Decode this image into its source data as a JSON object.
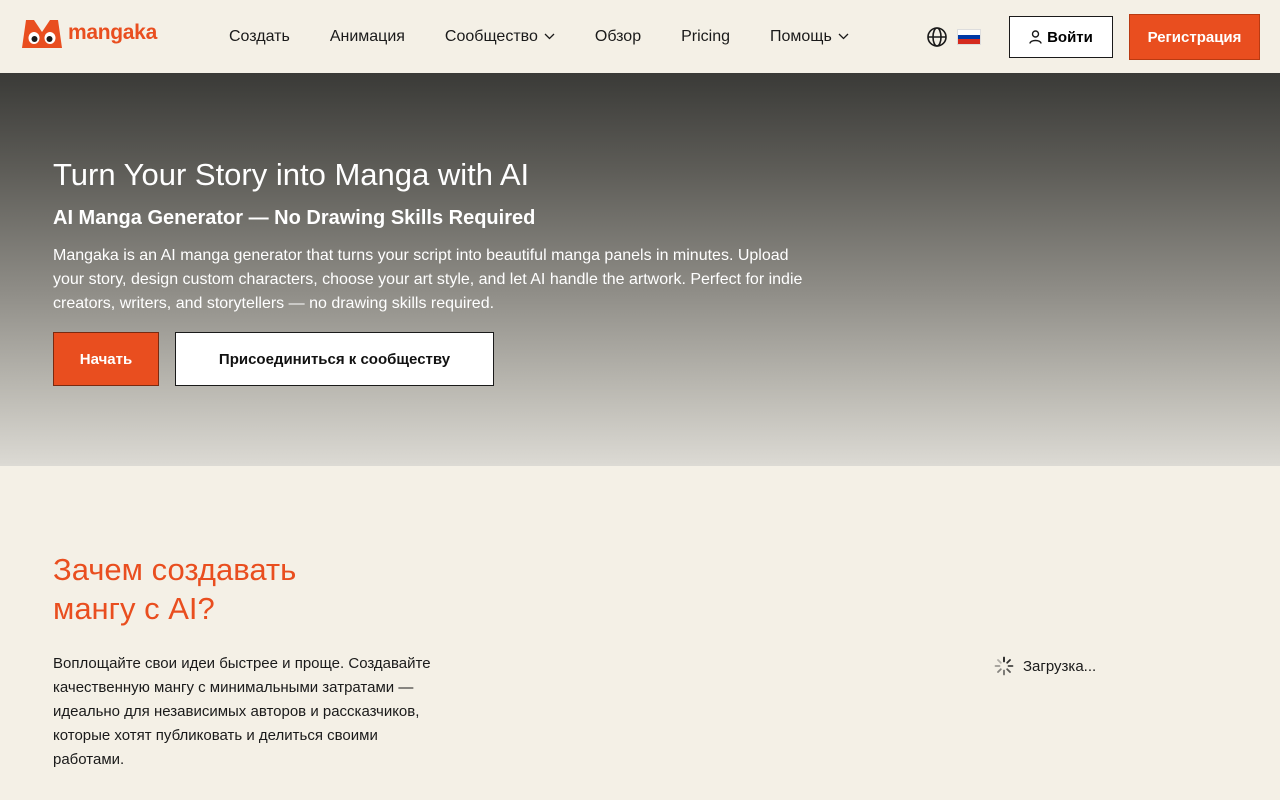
{
  "header": {
    "logo_text": "mangaka",
    "nav": [
      {
        "label": "Создать",
        "has_dropdown": false
      },
      {
        "label": "Анимация",
        "has_dropdown": false
      },
      {
        "label": "Сообщество",
        "has_dropdown": true
      },
      {
        "label": "Обзор",
        "has_dropdown": false
      },
      {
        "label": "Pricing",
        "has_dropdown": false
      },
      {
        "label": "Помощь",
        "has_dropdown": true
      }
    ],
    "login_label": "Войти",
    "register_label": "Регистрация"
  },
  "hero": {
    "title": "Turn Your Story into Manga with AI",
    "subtitle": "AI Manga Generator — No Drawing Skills Required",
    "description": "Mangaka is an AI manga generator that turns your script into beautiful manga panels in minutes. Upload your story, design custom characters, choose your art style, and let AI handle the artwork. Perfect for indie creators, writers, and storytellers — no drawing skills required.",
    "start_label": "Начать",
    "join_label": "Присоединиться к сообществу"
  },
  "why": {
    "title": "Зачем создавать мангу с AI?",
    "description": "Воплощайте свои идеи быстрее и проще. Создавайте качественную мангу с минимальными затратами — идеально для независимых авторов и рассказчиков, которые хотят публиковать и делиться своими работами.",
    "loading_label": "Загрузка..."
  },
  "colors": {
    "accent": "#e94e1f",
    "background": "#f4f0e6"
  },
  "icons": {
    "logo": "mangaka-logo-icon",
    "language": "globe-icon",
    "flag": "russia-flag-icon",
    "user": "user-icon",
    "dropdown": "chevron-down-icon",
    "loading": "spinner-icon"
  }
}
